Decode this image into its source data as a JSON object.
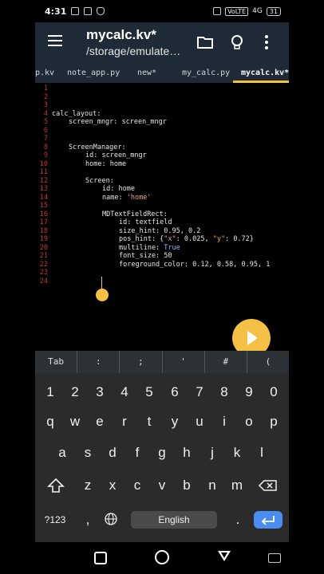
{
  "status": {
    "time": "4:31",
    "network": "VoLTE",
    "signal": "4G",
    "battery": "31"
  },
  "appbar": {
    "title": "mycalc.kv*",
    "subtitle": "/storage/emulate…"
  },
  "tabs": [
    {
      "label": "p.kv"
    },
    {
      "label": "note_app.py"
    },
    {
      "label": "new*"
    },
    {
      "label": "my_calc.py"
    },
    {
      "label": "mycalc.kv*"
    }
  ],
  "editor": {
    "line_numbers": [
      "1",
      "2",
      "3",
      "4",
      "5",
      "6",
      "7",
      "8",
      "9",
      "10",
      "11",
      "12",
      "13",
      "14",
      "15",
      "16",
      "17",
      "18",
      "19",
      "20",
      "21",
      "22",
      "23",
      "24"
    ],
    "code": {
      "l4": "calc_layout:",
      "l5": "screen_mngr: screen_mngr",
      "l8": "ScreenManager:",
      "l9": "id: screen_mngr",
      "l10": "home: home",
      "l12": "Screen:",
      "l13": "id: home",
      "l14_key": "name: ",
      "l14_val": "'home'",
      "l16": "MDTextFieldRect:",
      "l17": "id: textfield",
      "l18": "size_hint: 0.95, 0.2",
      "l19_a": "pos_hint: {",
      "l19_b": "\"x\"",
      "l19_c": ": 0.025, ",
      "l19_d": "\"y\"",
      "l19_e": ": 0.72}",
      "l20_key": "multiline: ",
      "l20_val": "True",
      "l21": "font_size: 50",
      "l22": "foreground_color: 0.12, 0.58, 0.95, 1"
    }
  },
  "symbols": [
    "Tab",
    ":",
    ";",
    "'",
    "#",
    "("
  ],
  "keyboard": {
    "row1": [
      "1",
      "2",
      "3",
      "4",
      "5",
      "6",
      "7",
      "8",
      "9",
      "0"
    ],
    "row2": [
      "q",
      "w",
      "e",
      "r",
      "t",
      "y",
      "u",
      "i",
      "o",
      "p"
    ],
    "row3": [
      "a",
      "s",
      "d",
      "f",
      "g",
      "h",
      "j",
      "k",
      "l"
    ],
    "row4": [
      "z",
      "x",
      "c",
      "v",
      "b",
      "n",
      "m"
    ],
    "sym_key": "?123",
    "comma": ",",
    "space_label": "English",
    "period": "."
  },
  "colors": {
    "accent": "#f5c046",
    "appbar": "#1e2a36",
    "line_number": "#c0392b",
    "enter": "#4a8cf0"
  }
}
